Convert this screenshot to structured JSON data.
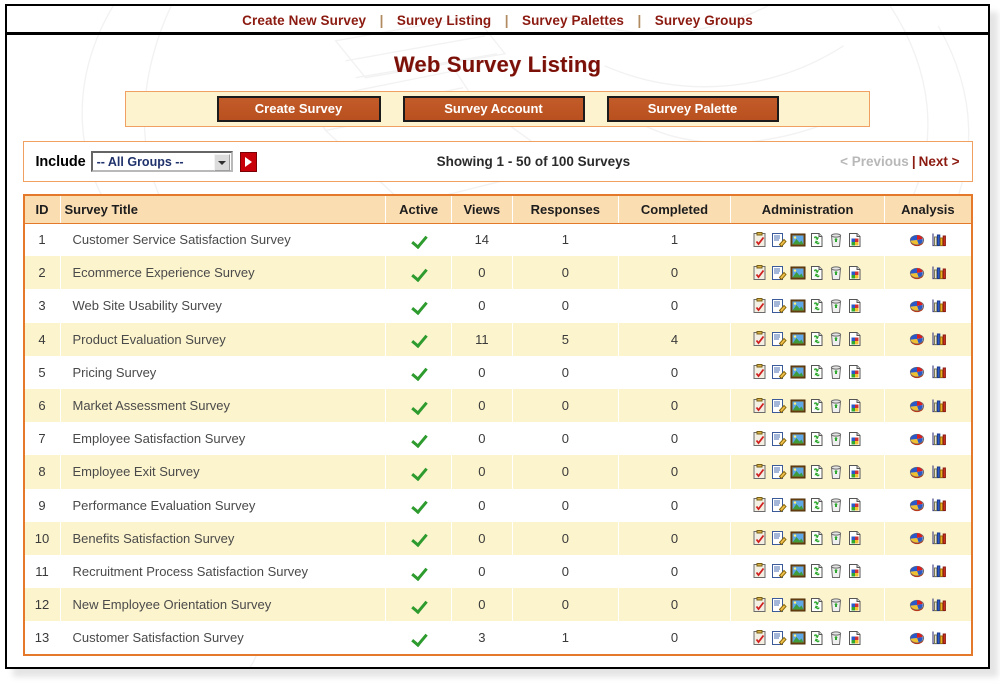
{
  "topnav": {
    "separator": "|",
    "items": [
      {
        "label": "Create New Survey",
        "name": "nav-create-new-survey"
      },
      {
        "label": "Survey Listing",
        "name": "nav-survey-listing"
      },
      {
        "label": "Survey Palettes",
        "name": "nav-survey-palettes"
      },
      {
        "label": "Survey Groups",
        "name": "nav-survey-groups"
      }
    ]
  },
  "page": {
    "title": "Web Survey Listing"
  },
  "actions": {
    "create_survey": "Create Survey",
    "survey_account": "Survey Account",
    "survey_palette": "Survey Palette"
  },
  "filter": {
    "include_label": "Include",
    "group_selected": "-- All Groups --",
    "group_options": [
      "-- All Groups --"
    ],
    "go_icon": "play-arrow-icon",
    "showing_text": "Showing 1 - 50 of 100 Surveys",
    "previous_label": "< Previous",
    "pager_separator": "|",
    "next_label": "Next >"
  },
  "table": {
    "headers": {
      "id": "ID",
      "title": "Survey Title",
      "active": "Active",
      "views": "Views",
      "responses": "Responses",
      "completed": "Completed",
      "administration": "Administration",
      "analysis": "Analysis"
    },
    "admin_icons": [
      "survey-preview-icon",
      "edit-survey-icon",
      "survey-images-icon",
      "copy-survey-icon",
      "delete-survey-icon",
      "export-survey-icon"
    ],
    "analysis_icons": [
      "pie-chart-icon",
      "bar-chart-icon"
    ],
    "active_icon": "green-check-icon",
    "rows": [
      {
        "id": "1",
        "title": "Customer Service Satisfaction Survey",
        "active": true,
        "views": "14",
        "responses": "1",
        "completed": "1"
      },
      {
        "id": "2",
        "title": "Ecommerce Experience Survey",
        "active": true,
        "views": "0",
        "responses": "0",
        "completed": "0"
      },
      {
        "id": "3",
        "title": "Web Site Usability Survey",
        "active": true,
        "views": "0",
        "responses": "0",
        "completed": "0"
      },
      {
        "id": "4",
        "title": "Product Evaluation Survey",
        "active": true,
        "views": "11",
        "responses": "5",
        "completed": "4"
      },
      {
        "id": "5",
        "title": "Pricing Survey",
        "active": true,
        "views": "0",
        "responses": "0",
        "completed": "0"
      },
      {
        "id": "6",
        "title": "Market Assessment Survey",
        "active": true,
        "views": "0",
        "responses": "0",
        "completed": "0"
      },
      {
        "id": "7",
        "title": "Employee Satisfaction Survey",
        "active": true,
        "views": "0",
        "responses": "0",
        "completed": "0"
      },
      {
        "id": "8",
        "title": "Employee Exit Survey",
        "active": true,
        "views": "0",
        "responses": "0",
        "completed": "0"
      },
      {
        "id": "9",
        "title": "Performance Evaluation Survey",
        "active": true,
        "views": "0",
        "responses": "0",
        "completed": "0"
      },
      {
        "id": "10",
        "title": "Benefits Satisfaction Survey",
        "active": true,
        "views": "0",
        "responses": "0",
        "completed": "0"
      },
      {
        "id": "11",
        "title": "Recruitment Process Satisfaction Survey",
        "active": true,
        "views": "0",
        "responses": "0",
        "completed": "0"
      },
      {
        "id": "12",
        "title": "New Employee Orientation Survey",
        "active": true,
        "views": "0",
        "responses": "0",
        "completed": "0"
      },
      {
        "id": "13",
        "title": "Customer Satisfaction Survey",
        "active": true,
        "views": "3",
        "responses": "1",
        "completed": "0"
      }
    ]
  },
  "colors": {
    "accent_orange": "#E4792B",
    "button_orange": "#C05A28",
    "title_maroon": "#7B1008",
    "link_maroon": "#8B1A10",
    "header_tan": "#FBDDB2",
    "row_alt": "#FCF4CD",
    "panel_cream": "#FDF3CF",
    "check_green": "#2E9B2E",
    "go_red": "#C8000A",
    "disabled_gray": "#B8B8B8"
  }
}
